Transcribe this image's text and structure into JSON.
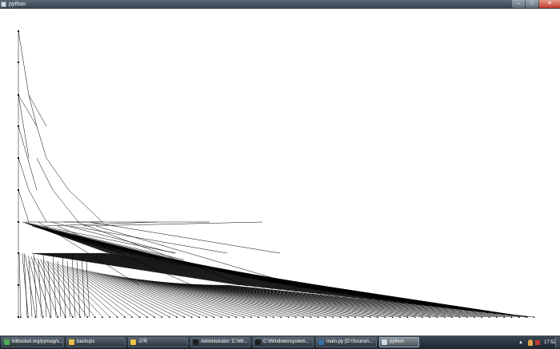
{
  "window": {
    "title": "python"
  },
  "title_controls": {
    "minimize_glyph": "–",
    "maximize_glyph": "□",
    "close_glyph": "✕"
  },
  "taskbar": {
    "items": [
      {
        "label": "bitbucket.org/pymag/s...",
        "icon": "chrome-icon",
        "color": "#4caf50",
        "active": false
      },
      {
        "label": "backups",
        "icon": "folder-icon",
        "color": "#e8c04a",
        "active": false
      },
      {
        "label": "교육",
        "icon": "folder-icon",
        "color": "#e8c04a",
        "active": false
      },
      {
        "label": "Administrator: C:\\Wi...",
        "icon": "console-icon",
        "color": "#1e1e1e",
        "active": false
      },
      {
        "label": "C:\\Windows\\system...",
        "icon": "console-icon",
        "color": "#1e1e1e",
        "active": false
      },
      {
        "label": "main.py (D:\\Source\\...",
        "icon": "editor-icon",
        "color": "#3b6ea8",
        "active": false
      },
      {
        "label": "python",
        "icon": "window-icon",
        "color": "#cfd8e0",
        "active": true
      }
    ]
  },
  "tray": {
    "show_hidden_glyph": "▲",
    "clock": "17:52"
  },
  "colors": {
    "canvas_background": "#ffffff",
    "line": "#000000",
    "taskbar": "#1d252d"
  }
}
